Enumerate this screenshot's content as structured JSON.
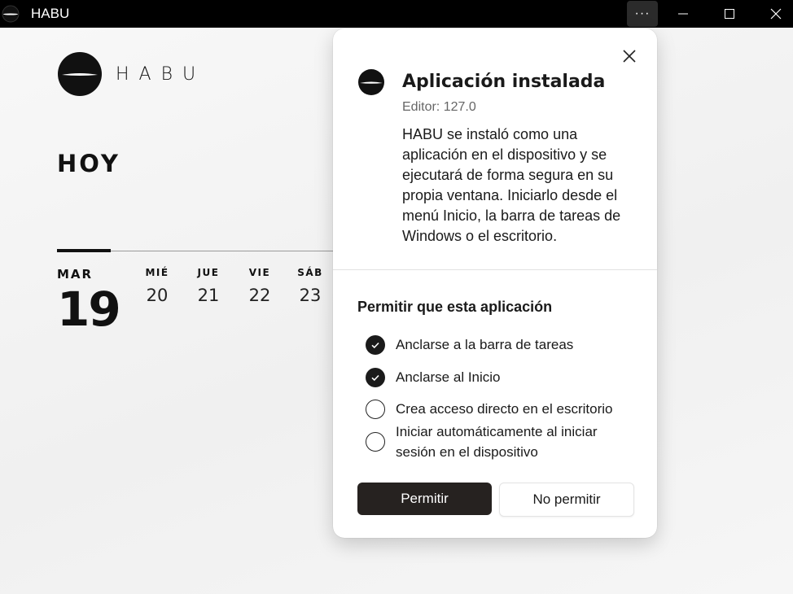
{
  "window": {
    "title": "HABU",
    "more_label": "···"
  },
  "app": {
    "brand": "HABU",
    "heading": "HOY",
    "days": [
      {
        "name": "MAR",
        "num": "19"
      },
      {
        "name": "MIÉ",
        "num": "20"
      },
      {
        "name": "JUE",
        "num": "21"
      },
      {
        "name": "VIE",
        "num": "22"
      },
      {
        "name": "SÁB",
        "num": "23"
      }
    ]
  },
  "dialog": {
    "title": "Aplicación instalada",
    "editor": "Editor: 127.0",
    "description": "HABU se instaló como una aplicación en el dispositivo y se ejecutará de forma segura en su propia ventana. Iniciarlo desde el menú Inicio, la barra de tareas de Windows o el escritorio.",
    "permissions_title": "Permitir que esta aplicación",
    "options": [
      {
        "label": "Anclarse a la barra de tareas",
        "checked": true
      },
      {
        "label": "Anclarse al Inicio",
        "checked": true
      },
      {
        "label": "Crea acceso directo en el escritorio",
        "checked": false
      },
      {
        "label": "Iniciar automáticamente al iniciar sesión en el dispositivo",
        "checked": false
      }
    ],
    "allow_label": "Permitir",
    "deny_label": "No permitir"
  },
  "colors": {
    "titlebar": "#000000",
    "primary_button": "#262220",
    "checked": "#1b1b1b"
  }
}
